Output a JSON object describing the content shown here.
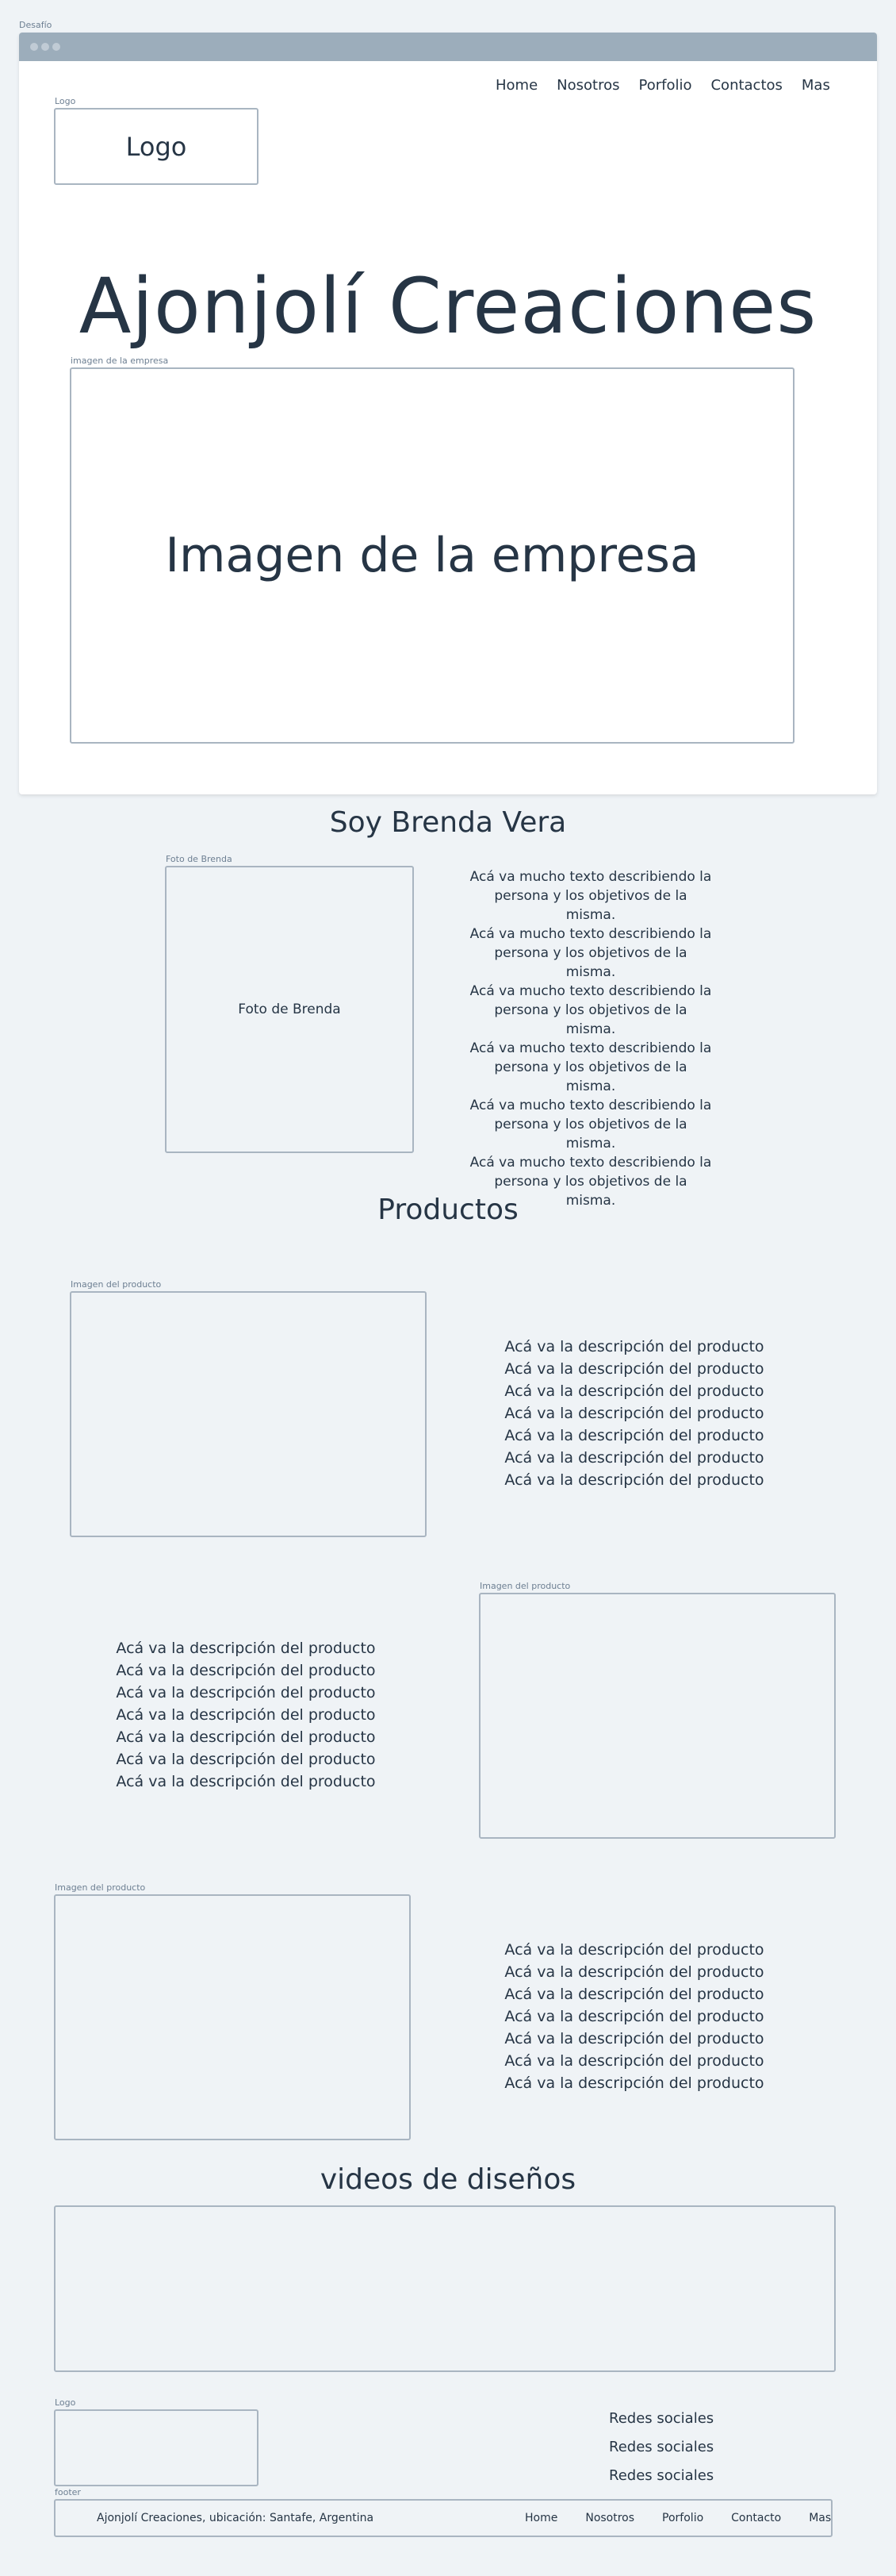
{
  "window": {
    "label": "Desafío"
  },
  "header": {
    "logo_tag": "Logo",
    "logo_text": "Logo",
    "nav": [
      "Home",
      "Nosotros",
      "Porfolio",
      "Contactos",
      "Mas"
    ]
  },
  "hero": {
    "title": "Ajonjolí Creaciones",
    "image_tag": "imagen de la empresa",
    "image_text": "Imagen de la empresa"
  },
  "about": {
    "title": "Soy Brenda Vera",
    "photo_tag": "Foto de Brenda",
    "photo_text": "Foto de Brenda",
    "lines": [
      "Acá va mucho texto describiendo la",
      "persona y los objetivos de la misma.",
      "Acá va mucho texto describiendo la",
      "persona y los objetivos de la misma.",
      "Acá va mucho texto describiendo la",
      "persona y los objetivos de la misma.",
      "Acá va mucho texto describiendo la",
      "persona y los objetivos de la misma.",
      "Acá va mucho texto describiendo la",
      "persona y los objetivos de la misma.",
      "Acá va mucho texto describiendo la",
      "persona y los objetivos de la misma."
    ]
  },
  "products": {
    "title": "Productos",
    "items": [
      {
        "image_tag": "Imagen del producto",
        "description": [
          "Acá va la descripción del producto",
          "Acá va la descripción del producto",
          "Acá va la descripción del producto",
          "Acá va la descripción del producto",
          "Acá va la descripción del producto",
          "Acá va la descripción del producto",
          "Acá va la descripción del producto"
        ]
      },
      {
        "image_tag": "Imagen del producto",
        "description": [
          "Acá va la descripción del producto",
          "Acá va la descripción del producto",
          "Acá va la descripción del producto",
          "Acá va la descripción del producto",
          "Acá va la descripción del producto",
          "Acá va la descripción del producto",
          "Acá va la descripción del producto"
        ]
      },
      {
        "image_tag": "Imagen del producto",
        "description": [
          "Acá va la descripción del producto",
          "Acá va la descripción del producto",
          "Acá va la descripción del producto",
          "Acá va la descripción del producto",
          "Acá va la descripción del producto",
          "Acá va la descripción del producto",
          "Acá va la descripción del producto"
        ]
      }
    ]
  },
  "videos": {
    "title": "videos de diseños"
  },
  "bottom": {
    "logo_tag": "Logo",
    "social": [
      "Redes sociales",
      "Redes sociales",
      "Redes sociales"
    ]
  },
  "footer": {
    "tag": "footer",
    "text": "Ajonjolí Creaciones, ubicación: Santafe, Argentina",
    "nav": [
      "Home",
      "Nosotros",
      "Porfolio",
      "Contacto",
      "Mas"
    ]
  },
  "colors": {
    "background": "#eff3f6",
    "titlebar": "#9cadbb",
    "border": "#a9b5c1",
    "text": "#263545"
  }
}
